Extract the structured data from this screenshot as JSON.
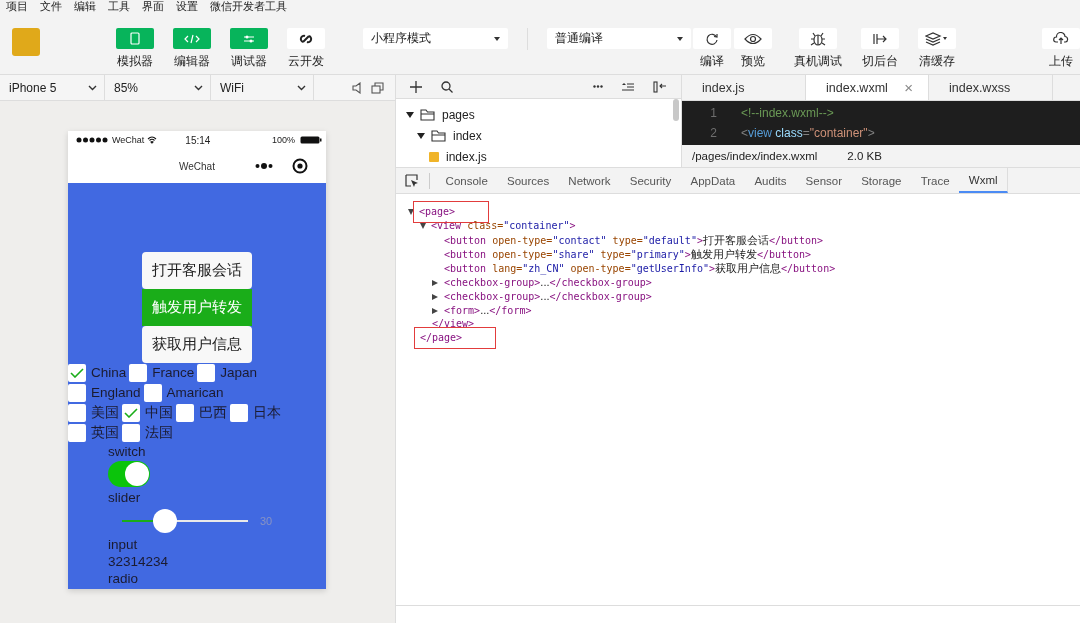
{
  "menu": [
    "项目",
    "文件",
    "编辑",
    "工具",
    "界面",
    "设置",
    "微信开发者工具"
  ],
  "toolbar": {
    "modes": [
      {
        "label": "模拟器",
        "kind": "phone",
        "on": true
      },
      {
        "label": "编辑器",
        "kind": "code",
        "on": true
      },
      {
        "label": "调试器",
        "kind": "sliders",
        "on": true
      },
      {
        "label": "云开发",
        "kind": "link",
        "on": false
      }
    ],
    "mode_select": "小程序模式",
    "compile_select": "普通编译",
    "actions": [
      {
        "label": "编译",
        "kind": "refresh"
      },
      {
        "label": "预览",
        "kind": "eye"
      },
      {
        "label": "真机调试",
        "kind": "bug"
      },
      {
        "label": "切后台",
        "kind": "switch"
      },
      {
        "label": "清缓存",
        "kind": "layers"
      },
      {
        "label": "上传",
        "kind": "cloud"
      }
    ]
  },
  "simulator": {
    "device": "iPhone 5",
    "zoom": "85%",
    "network": "WiFi",
    "phone": {
      "carrier": "WeChat",
      "time": "15:14",
      "battery": "100%",
      "nav_title": "WeChat",
      "buttons": [
        {
          "label": "打开客服会话",
          "kind": "default"
        },
        {
          "label": "触发用户转发",
          "kind": "primary"
        },
        {
          "label": "获取用户信息",
          "kind": "default"
        }
      ],
      "checkbox_groups": [
        [
          {
            "label": "China",
            "checked": true
          },
          {
            "label": "France",
            "checked": false
          },
          {
            "label": "Japan",
            "checked": false
          },
          {
            "label": "England",
            "checked": false
          },
          {
            "label": "Amarican",
            "checked": false
          }
        ],
        [
          {
            "label": "美国",
            "checked": false
          },
          {
            "label": "中国",
            "checked": true
          },
          {
            "label": "巴西",
            "checked": false
          },
          {
            "label": "日本",
            "checked": false
          },
          {
            "label": "英国",
            "checked": false
          },
          {
            "label": "法国",
            "checked": false
          }
        ]
      ],
      "switch": {
        "label": "switch",
        "on": true
      },
      "slider": {
        "label": "slider",
        "level": 0.3,
        "reading": "30"
      },
      "input": {
        "label": "input",
        "value": "32314234"
      },
      "radio": {
        "label": "radio"
      }
    }
  },
  "file_tree": [
    {
      "name": "pages",
      "kind": "folder",
      "expanded": true,
      "children": [
        {
          "name": "index",
          "kind": "folder",
          "expanded": true,
          "children": [
            {
              "name": "index.js",
              "kind": "js"
            }
          ]
        }
      ]
    }
  ],
  "editor": {
    "tabs": [
      {
        "label": "index.js",
        "selected": false
      },
      {
        "label": "index.wxml",
        "selected": true,
        "close": "×"
      },
      {
        "label": "index.wxss",
        "selected": false
      }
    ],
    "lines": [
      {
        "number": "1",
        "tokens": [
          {
            "kind": "comment",
            "text": "<!--index.wxml-->"
          }
        ]
      },
      {
        "number": "2",
        "tokens": [
          {
            "kind": "punct",
            "text": "<"
          },
          {
            "kind": "tag",
            "text": "view"
          },
          {
            "kind": "attr",
            "text": " class"
          },
          {
            "kind": "punct",
            "text": "="
          },
          {
            "kind": "value",
            "text": "\"container\""
          },
          {
            "kind": "punct",
            "text": ">"
          }
        ]
      }
    ],
    "path": "/pages/index/index.wxml",
    "size": "2.0 KB"
  },
  "devtools": {
    "tabs": [
      {
        "label": "Console",
        "selected": false
      },
      {
        "label": "Sources",
        "selected": false
      },
      {
        "label": "Network",
        "selected": false
      },
      {
        "label": "Security",
        "selected": false
      },
      {
        "label": "AppData",
        "selected": false
      },
      {
        "label": "Audits",
        "selected": false
      },
      {
        "label": "Sensor",
        "selected": false
      },
      {
        "label": "Storage",
        "selected": false
      },
      {
        "label": "Trace",
        "selected": false
      },
      {
        "label": "Wxml",
        "selected": true
      }
    ],
    "wxml": [
      {
        "expanded": true,
        "highlighted": true,
        "open": [
          {
            "kind": "tag",
            "text": "<page>"
          }
        ],
        "close": [
          {
            "kind": "tag",
            "text": "</page>"
          }
        ],
        "children": [
          {
            "expanded": true,
            "highlighted": false,
            "open": [
              {
                "kind": "tag",
                "text": "<view "
              },
              {
                "kind": "attr",
                "text": "class="
              },
              {
                "kind": "value",
                "text": "\"container\""
              },
              {
                "kind": "tag",
                "text": ">"
              }
            ],
            "close": [
              {
                "kind": "tag",
                "text": "</view>"
              }
            ],
            "children": [
              {
                "open": [
                  {
                    "kind": "tag",
                    "text": "<button "
                  },
                  {
                    "kind": "attr",
                    "text": "open-type="
                  },
                  {
                    "kind": "value",
                    "text": "\"contact\" "
                  },
                  {
                    "kind": "attr",
                    "text": "type="
                  },
                  {
                    "kind": "value",
                    "text": "\"default\""
                  },
                  {
                    "kind": "tag",
                    "text": ">"
                  },
                  {
                    "kind": "text",
                    "text": "打开客服会话"
                  },
                  {
                    "kind": "tag",
                    "text": "</button>"
                  }
                ]
              },
              {
                "open": [
                  {
                    "kind": "tag",
                    "text": "<button "
                  },
                  {
                    "kind": "attr",
                    "text": "open-type="
                  },
                  {
                    "kind": "value",
                    "text": "\"share\" "
                  },
                  {
                    "kind": "attr",
                    "text": "type="
                  },
                  {
                    "kind": "value",
                    "text": "\"primary\""
                  },
                  {
                    "kind": "tag",
                    "text": ">"
                  },
                  {
                    "kind": "text",
                    "text": "触发用户转发"
                  },
                  {
                    "kind": "tag",
                    "text": "</button>"
                  }
                ]
              },
              {
                "open": [
                  {
                    "kind": "tag",
                    "text": "<button "
                  },
                  {
                    "kind": "attr",
                    "text": "lang="
                  },
                  {
                    "kind": "value",
                    "text": "\"zh_CN\" "
                  },
                  {
                    "kind": "attr",
                    "text": "open-type="
                  },
                  {
                    "kind": "value",
                    "text": "\"getUserInfo\""
                  },
                  {
                    "kind": "tag",
                    "text": ">"
                  },
                  {
                    "kind": "text",
                    "text": "获取用户信息"
                  },
                  {
                    "kind": "tag",
                    "text": "</button>"
                  }
                ]
              },
              {
                "expanded": false,
                "open": [
                  {
                    "kind": "tag",
                    "text": "<checkbox-group>"
                  },
                  {
                    "kind": "text",
                    "text": "..."
                  },
                  {
                    "kind": "tag",
                    "text": "</checkbox-group>"
                  }
                ]
              },
              {
                "expanded": false,
                "open": [
                  {
                    "kind": "tag",
                    "text": "<checkbox-group>"
                  },
                  {
                    "kind": "text",
                    "text": "..."
                  },
                  {
                    "kind": "tag",
                    "text": "</checkbox-group>"
                  }
                ]
              },
              {
                "expanded": false,
                "open": [
                  {
                    "kind": "tag",
                    "text": "<form>"
                  },
                  {
                    "kind": "text",
                    "text": "..."
                  },
                  {
                    "kind": "tag",
                    "text": "</form>"
                  }
                ]
              }
            ]
          }
        ]
      }
    ]
  }
}
